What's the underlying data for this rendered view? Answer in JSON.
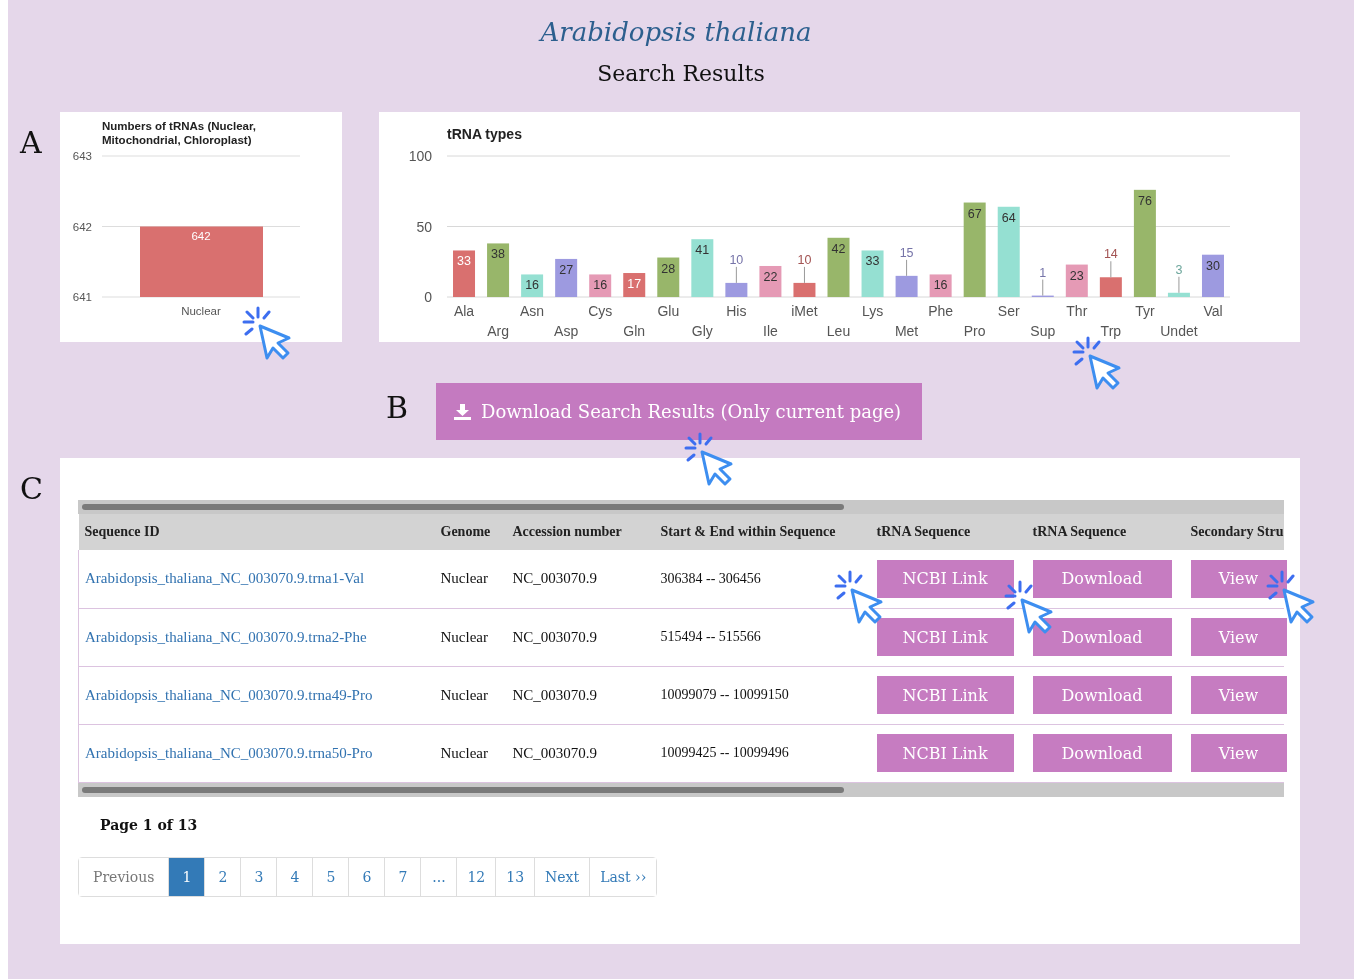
{
  "species": "Arabidopsis thaliana",
  "heading": "Search Results",
  "panel_labels": [
    "A",
    "B",
    "C"
  ],
  "genome_chart": {
    "chart_data": {
      "type": "bar",
      "title": "Numbers of tRNAs (Nuclear, Mitochondrial, Chloroplast)",
      "categories": [
        "Nuclear"
      ],
      "series": [
        {
          "color": "#d9706f",
          "values": [
            642
          ]
        }
      ],
      "ylim": [
        641,
        643
      ],
      "yticks": [
        641,
        642,
        643
      ],
      "data_labels": true
    }
  },
  "types_chart": {
    "chart_data": {
      "type": "bar",
      "title": "tRNA types",
      "categories": [
        "Ala",
        "Arg",
        "Asn",
        "Asp",
        "Cys",
        "Gln",
        "Glu",
        "Gly",
        "His",
        "Ile",
        "iMet",
        "Leu",
        "Lys",
        "Met",
        "Phe",
        "Pro",
        "Ser",
        "Sup",
        "Thr",
        "Trp",
        "Tyr",
        "Undet",
        "Val"
      ],
      "series": [
        {
          "values": [
            33,
            38,
            16,
            27,
            16,
            17,
            28,
            41,
            10,
            22,
            10,
            42,
            33,
            15,
            16,
            67,
            64,
            1,
            23,
            14,
            76,
            3,
            30
          ],
          "colors": [
            "#d9706f",
            "#98b66a",
            "#95e0d2",
            "#9d9ae0",
            "#e59ab5",
            "#d9706f",
            "#98b66a",
            "#95e0d2",
            "#9d9ae0",
            "#e59ab5",
            "#d9706f",
            "#98b66a",
            "#95e0d2",
            "#9d9ae0",
            "#e59ab5",
            "#98b66a",
            "#95e0d2",
            "#9d9ae0",
            "#e59ab5",
            "#d9706f",
            "#98b66a",
            "#95e0d2",
            "#9d9ae0"
          ]
        }
      ],
      "ylim": [
        0,
        100
      ],
      "yticks": [
        0,
        50,
        100
      ],
      "data_labels": true
    }
  },
  "download_button": "Download Search Results (Only current page)",
  "table": {
    "columns": [
      "Sequence ID",
      "Genome",
      "Accession number",
      "Start & End within Sequence",
      "tRNA Sequence",
      "tRNA Sequence",
      "Secondary Stru"
    ],
    "rows": [
      {
        "sequence_id": "Arabidopsis_thaliana_NC_003070.9.trna1-Val",
        "genome": "Nuclear",
        "accession": "NC_003070.9",
        "range": "306384 -- 306456",
        "buttons": [
          "NCBI Link",
          "Download",
          "View"
        ]
      },
      {
        "sequence_id": "Arabidopsis_thaliana_NC_003070.9.trna2-Phe",
        "genome": "Nuclear",
        "accession": "NC_003070.9",
        "range": "515494 -- 515566",
        "buttons": [
          "NCBI Link",
          "Download",
          "View"
        ]
      },
      {
        "sequence_id": "Arabidopsis_thaliana_NC_003070.9.trna49-Pro",
        "genome": "Nuclear",
        "accession": "NC_003070.9",
        "range": "10099079 -- 10099150",
        "buttons": [
          "NCBI Link",
          "Download",
          "View"
        ]
      },
      {
        "sequence_id": "Arabidopsis_thaliana_NC_003070.9.trna50-Pro",
        "genome": "Nuclear",
        "accession": "NC_003070.9",
        "range": "10099425 -- 10099496",
        "buttons": [
          "NCBI Link",
          "Download",
          "View"
        ]
      }
    ]
  },
  "page_info": "Page 1 of 13",
  "pagination": [
    {
      "label": "Previous",
      "selected": false
    },
    {
      "label": "1",
      "selected": true
    },
    {
      "label": "2",
      "selected": false
    },
    {
      "label": "3",
      "selected": false
    },
    {
      "label": "4",
      "selected": false
    },
    {
      "label": "5",
      "selected": false
    },
    {
      "label": "6",
      "selected": false
    },
    {
      "label": "7",
      "selected": false
    },
    {
      "label": "...",
      "selected": false
    },
    {
      "label": "12",
      "selected": false
    },
    {
      "label": "13",
      "selected": false
    },
    {
      "label": "Next",
      "selected": false
    },
    {
      "label": "Last ››",
      "selected": false
    }
  ]
}
